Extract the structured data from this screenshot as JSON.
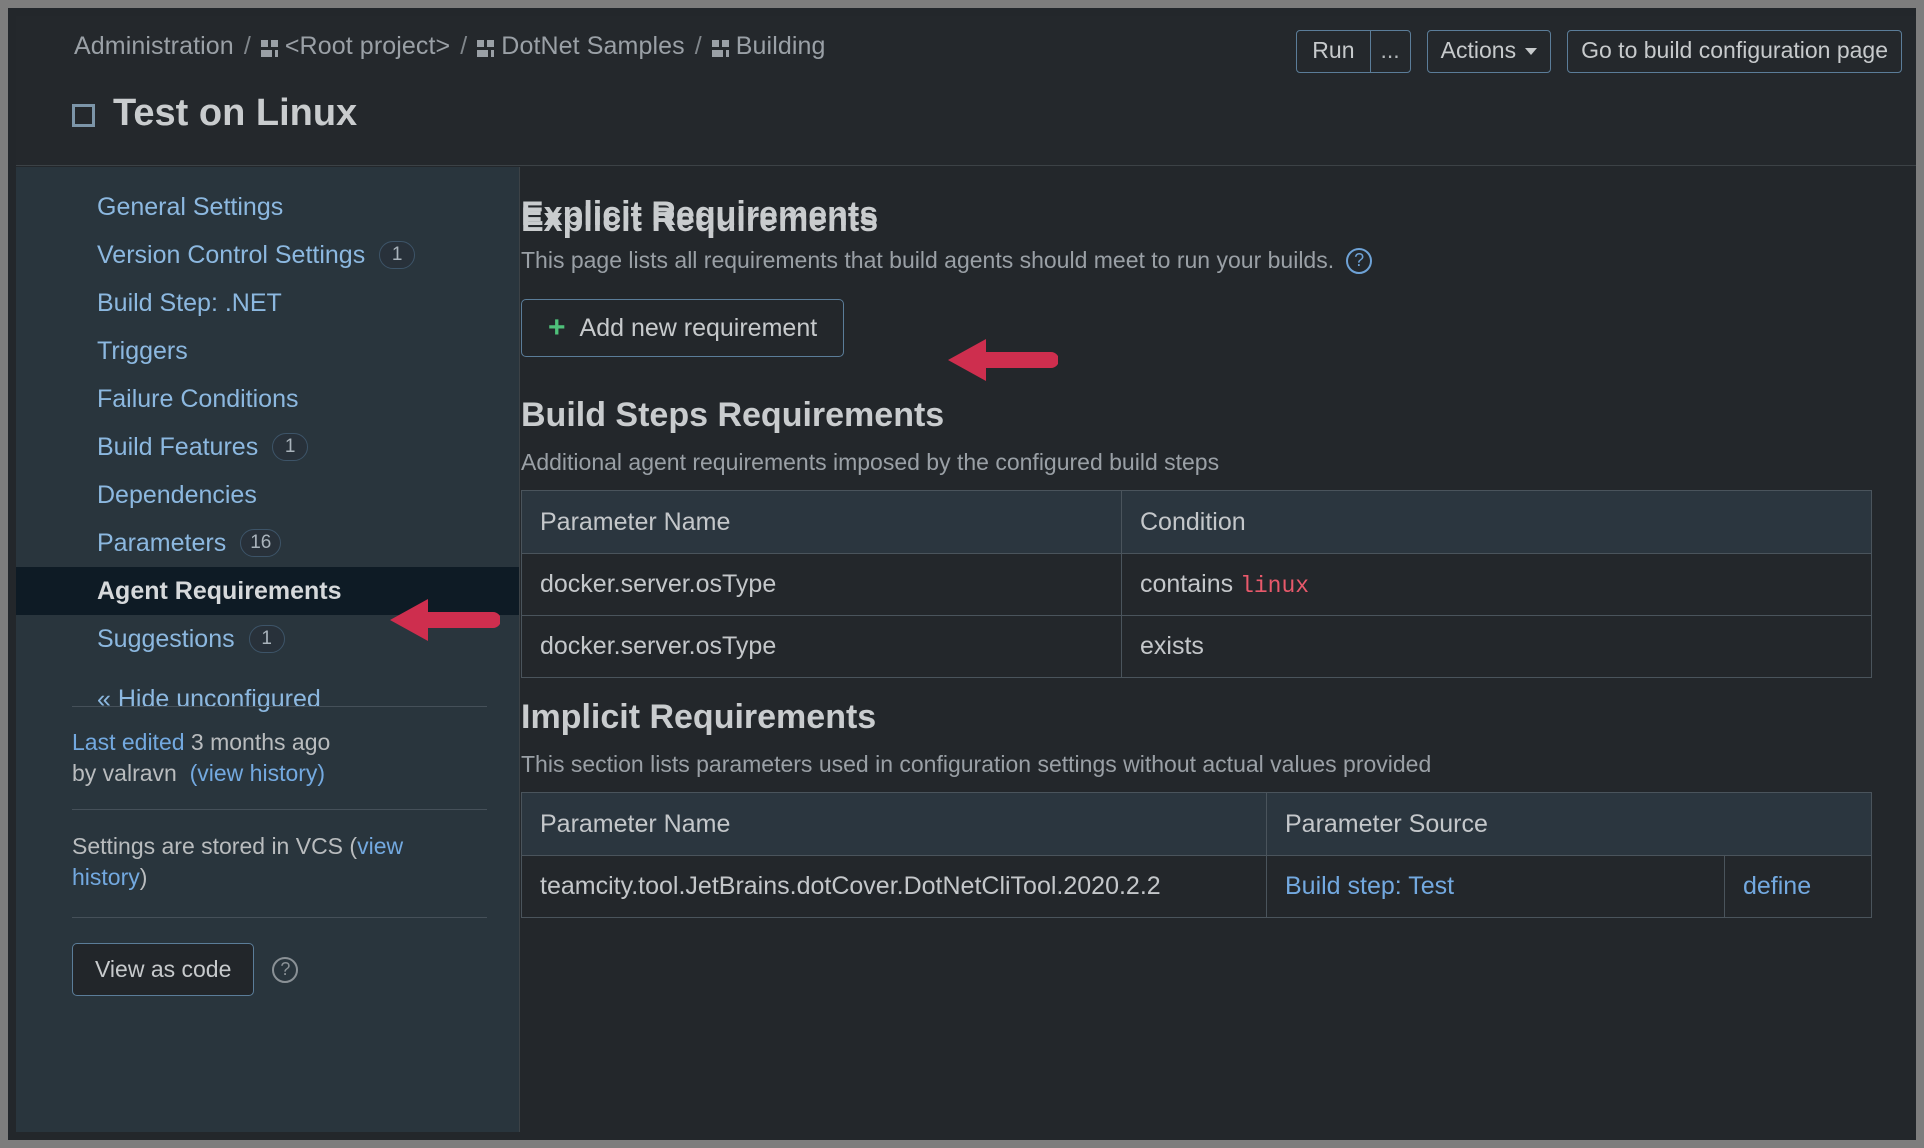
{
  "header": {
    "breadcrumb": [
      {
        "label": "Administration",
        "icon": null
      },
      {
        "label": "<Root project>",
        "icon": "project-icon"
      },
      {
        "label": "DotNet Samples",
        "icon": "project-icon"
      },
      {
        "label": "Building",
        "icon": "project-icon"
      }
    ],
    "separator": "/",
    "title": "Test on Linux",
    "title_icon": "build-configuration-icon",
    "buttons": {
      "run_label": "Run",
      "run_more_label": "...",
      "actions_label": "Actions",
      "actions_caret_icon": "chevron-down-icon",
      "go_to_build_label": "Go to build configuration page"
    }
  },
  "sidebar": {
    "items": [
      {
        "label": "General Settings",
        "badge": null,
        "selected": false
      },
      {
        "label": "Version Control Settings",
        "badge": "1",
        "selected": false
      },
      {
        "label": "Build Step: .NET",
        "badge": null,
        "selected": false
      },
      {
        "label": "Triggers",
        "badge": null,
        "selected": false
      },
      {
        "label": "Failure Conditions",
        "badge": null,
        "selected": false
      },
      {
        "label": "Build Features",
        "badge": "1",
        "selected": false
      },
      {
        "label": "Dependencies",
        "badge": null,
        "selected": false
      },
      {
        "label": "Parameters",
        "badge": "16",
        "selected": false
      },
      {
        "label": "Agent Requirements",
        "badge": null,
        "selected": true
      },
      {
        "label": "Suggestions",
        "badge": "1",
        "selected": false
      }
    ],
    "hide_unconfigured": "« Hide unconfigured",
    "meta": {
      "last_edited_link": "Last edited",
      "last_edited_when": "3 months ago",
      "by_line": "by valravn",
      "view_history_1": "(view history)",
      "vcs_text_prefix": "Settings are stored in VCS (",
      "vcs_link": "view history",
      "vcs_text_suffix": ")",
      "view_as_code_label": "View as code",
      "help_icon": "question-mark-icon"
    }
  },
  "main": {
    "explicit": {
      "title": "Explicit Requirements",
      "description": "This page lists all requirements that build agents should meet to run your builds.",
      "help_icon": "question-mark-icon",
      "add_button_label": "Add new requirement",
      "add_button_icon": "plus-icon"
    },
    "build_steps": {
      "title": "Build Steps Requirements",
      "description": "Additional agent requirements imposed by the configured build steps",
      "columns": [
        "Parameter Name",
        "Condition"
      ],
      "rows": [
        {
          "name": "docker.server.osType",
          "condition_prefix": "contains ",
          "condition_value": "linux"
        },
        {
          "name": "docker.server.osType",
          "condition_prefix": "exists",
          "condition_value": ""
        }
      ]
    },
    "implicit": {
      "title": "Implicit Requirements",
      "description": "This section lists parameters used in configuration settings without actual values provided",
      "columns": [
        "Parameter Name",
        "Parameter Source"
      ],
      "rows": [
        {
          "name": "teamcity.tool.JetBrains.dotCover.DotNetCliTool.2020.2.2",
          "source": "Build step: Test",
          "action": "define"
        }
      ]
    }
  },
  "annotations": {
    "arrow_color": "#ce2e4e",
    "arrows": [
      {
        "name": "arrow-to-add-new-requirement"
      },
      {
        "name": "arrow-to-agent-requirements"
      }
    ]
  }
}
